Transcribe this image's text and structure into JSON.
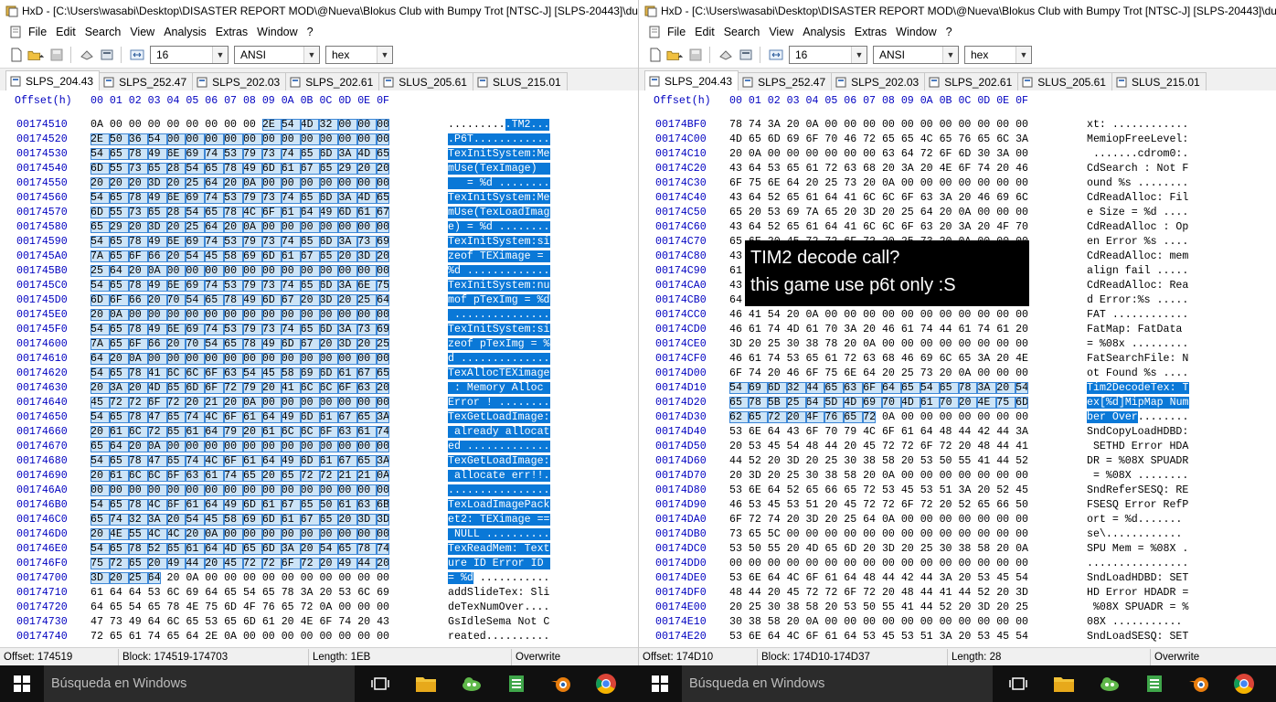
{
  "left": {
    "title": "HxD - [C:\\Users\\wasabi\\Desktop\\DISASTER REPORT MOD\\@Nueva\\Blokus Club with Bumpy Trot [NTSC-J] [SLPS-20443]\\dump\\SLPS_204.43]",
    "menu": [
      "File",
      "Edit",
      "Search",
      "View",
      "Analysis",
      "Extras",
      "Window",
      "?"
    ],
    "toolbar": {
      "bytes_per_row": "16",
      "charset": "ANSI",
      "offset_base": "hex"
    },
    "tabs": [
      "SLPS_204.43",
      "SLPS_252.47",
      "SLPS_202.03",
      "SLPS_202.61",
      "SLUS_205.61",
      "SLUS_215.01"
    ],
    "header": "Offset(h) 00 01 02 03 04 05 06 07 08 09 0A 0B 0C 0D 0E 0F",
    "rows": [
      [
        "00174510",
        "0A 00 00 00 00 00 00 00 00 2E 54 4D 32 00 00 00",
        "..........TM2..."
      ],
      [
        "00174520",
        "2E 50 36 54 00 00 00 00 00 00 00 00 00 00 00 00",
        ".P6T............"
      ],
      [
        "00174530",
        "54 65 78 49 6E 69 74 53 79 73 74 65 6D 3A 4D 65",
        "TexInitSystem:Me"
      ],
      [
        "00174540",
        "6D 55 73 65 28 54 65 78 49 6D 61 67 65 29 20 20",
        "mUse(TexImage)  "
      ],
      [
        "00174550",
        "20 20 20 3D 20 25 64 20 0A 00 00 00 00 00 00 00",
        "   = %d ........"
      ],
      [
        "00174560",
        "54 65 78 49 6E 69 74 53 79 73 74 65 6D 3A 4D 65",
        "TexInitSystem:Me"
      ],
      [
        "00174570",
        "6D 55 73 65 28 54 65 78 4C 6F 61 64 49 6D 61 67",
        "mUse(TexLoadImag"
      ],
      [
        "00174580",
        "65 29 20 3D 20 25 64 20 0A 00 00 00 00 00 00 00",
        "e) = %d ........"
      ],
      [
        "00174590",
        "54 65 78 49 6E 69 74 53 79 73 74 65 6D 3A 73 69",
        "TexInitSystem:si"
      ],
      [
        "001745A0",
        "7A 65 6F 66 20 54 45 58 69 6D 61 67 65 20 3D 20",
        "zeof TEXimage = "
      ],
      [
        "001745B0",
        "25 64 20 0A 00 00 00 00 00 00 00 00 00 00 00 00",
        "%d ............."
      ],
      [
        "001745C0",
        "54 65 78 49 6E 69 74 53 79 73 74 65 6D 3A 6E 75",
        "TexInitSystem:nu"
      ],
      [
        "001745D0",
        "6D 6F 66 20 70 54 65 78 49 6D 67 20 3D 20 25 64",
        "mof pTexImg = %d"
      ],
      [
        "001745E0",
        "20 0A 00 00 00 00 00 00 00 00 00 00 00 00 00 00",
        " ..............."
      ],
      [
        "001745F0",
        "54 65 78 49 6E 69 74 53 79 73 74 65 6D 3A 73 69",
        "TexInitSystem:si"
      ],
      [
        "00174600",
        "7A 65 6F 66 20 70 54 65 78 49 6D 67 20 3D 20 25",
        "zeof pTexImg = %"
      ],
      [
        "00174610",
        "64 20 0A 00 00 00 00 00 00 00 00 00 00 00 00 00",
        "d .............."
      ],
      [
        "00174620",
        "54 65 78 41 6C 6C 6F 63 54 45 58 69 6D 61 67 65",
        "TexAllocTEXimage"
      ],
      [
        "00174630",
        "20 3A 20 4D 65 6D 6F 72 79 20 41 6C 6C 6F 63 20",
        " : Memory Alloc "
      ],
      [
        "00174640",
        "45 72 72 6F 72 20 21 20 0A 00 00 00 00 00 00 00",
        "Error ! ........"
      ],
      [
        "00174650",
        "54 65 78 47 65 74 4C 6F 61 64 49 6D 61 67 65 3A",
        "TexGetLoadImage:"
      ],
      [
        "00174660",
        "20 61 6C 72 65 61 64 79 20 61 6C 6C 6F 63 61 74",
        " already allocat"
      ],
      [
        "00174670",
        "65 64 20 0A 00 00 00 00 00 00 00 00 00 00 00 00",
        "ed ............."
      ],
      [
        "00174680",
        "54 65 78 47 65 74 4C 6F 61 64 49 6D 61 67 65 3A",
        "TexGetLoadImage:"
      ],
      [
        "00174690",
        "20 61 6C 6C 6F 63 61 74 65 20 65 72 72 21 21 0A",
        " allocate err!!."
      ],
      [
        "001746A0",
        "00 00 00 00 00 00 00 00 00 00 00 00 00 00 00 00",
        "................"
      ],
      [
        "001746B0",
        "54 65 78 4C 6F 61 64 49 6D 61 67 65 50 61 63 6B",
        "TexLoadImagePack"
      ],
      [
        "001746C0",
        "65 74 32 3A 20 54 45 58 69 6D 61 67 65 20 3D 3D",
        "et2: TEXimage =="
      ],
      [
        "001746D0",
        "20 4E 55 4C 4C 20 0A 00 00 00 00 00 00 00 00 00",
        " NULL .........."
      ],
      [
        "001746E0",
        "54 65 78 52 65 61 64 4D 65 6D 3A 20 54 65 78 74",
        "TexReadMem: Text"
      ],
      [
        "001746F0",
        "75 72 65 20 49 44 20 45 72 72 6F 72 20 49 44 20",
        "ure ID Error ID "
      ],
      [
        "00174700",
        "3D 20 25 64 20 0A 00 00 00 00 00 00 00 00 00 00",
        "= %d ..........."
      ],
      [
        "00174710",
        "61 64 64 53 6C 69 64 65 54 65 78 3A 20 53 6C 69",
        "addSlideTex: Sli"
      ],
      [
        "00174720",
        "64 65 54 65 78 4E 75 6D 4F 76 65 72 0A 00 00 00",
        "deTexNumOver...."
      ],
      [
        "00174730",
        "47 73 49 64 6C 65 53 65 6D 61 20 4E 6F 74 20 43",
        "GsIdleSema Not C"
      ],
      [
        "00174740",
        "72 65 61 74 65 64 2E 0A 00 00 00 00 00 00 00 00",
        "reated.........."
      ]
    ],
    "status": {
      "offset": "Offset: 174519",
      "block": "Block: 174519-174703",
      "length": "Length: 1EB",
      "mode": "Overwrite"
    }
  },
  "right": {
    "title": "HxD - [C:\\Users\\wasabi\\Desktop\\DISASTER REPORT MOD\\@Nueva\\Blokus Club with Bumpy Trot [NTSC-J] [SLPS-20443]\\dump\\SLPS_204.43]",
    "menu": [
      "File",
      "Edit",
      "Search",
      "View",
      "Analysis",
      "Extras",
      "Window",
      "?"
    ],
    "toolbar": {
      "bytes_per_row": "16",
      "charset": "ANSI",
      "offset_base": "hex"
    },
    "tabs": [
      "SLPS_204.43",
      "SLPS_252.47",
      "SLPS_202.03",
      "SLPS_202.61",
      "SLUS_205.61",
      "SLUS_215.01"
    ],
    "header": "Offset(h) 00 01 02 03 04 05 06 07 08 09 0A 0B 0C 0D 0E 0F",
    "rows": [
      [
        "00174BF0",
        "78 74 3A 20 0A 00 00 00 00 00 00 00 00 00 00 00",
        "xt: ............"
      ],
      [
        "00174C00",
        "4D 65 6D 69 6F 70 46 72 65 65 4C 65 76 65 6C 3A",
        "MemiopFreeLevel:"
      ],
      [
        "00174C10",
        "20 0A 00 00 00 00 00 00 63 64 72 6F 6D 30 3A 00",
        " .......cdrom0:."
      ],
      [
        "00174C20",
        "43 64 53 65 61 72 63 68 20 3A 20 4E 6F 74 20 46",
        "CdSearch : Not F"
      ],
      [
        "00174C30",
        "6F 75 6E 64 20 25 73 20 0A 00 00 00 00 00 00 00",
        "ound %s ........"
      ],
      [
        "00174C40",
        "43 64 52 65 61 64 41 6C 6C 6F 63 3A 20 46 69 6C",
        "CdReadAlloc: Fil"
      ],
      [
        "00174C50",
        "65 20 53 69 7A 65 20 3D 20 25 64 20 0A 00 00 00",
        "e Size = %d ...."
      ],
      [
        "00174C60",
        "43 64 52 65 61 64 41 6C 6C 6F 63 20 3A 20 4F 70",
        "CdReadAlloc : Op"
      ],
      [
        "00174C70",
        "65 6E 20 45 72 72 6F 72 20 25 73 20 0A 00 00 00",
        "en Error %s ...."
      ],
      [
        "00174C80",
        "43 64 52 65 61 64 41 6C 6C 6F 63 3A 20 6D 65 6D",
        "CdReadAlloc: mem"
      ],
      [
        "00174C90",
        "61 6C 69 67 6E 20 66 61 69 6C 20 0A 00 00 00 00",
        "align fail ....."
      ],
      [
        "00174CA0",
        "43 64 52 65 61 64 41 6C 6C 6F 63 3A 20 52 65 61",
        "CdReadAlloc: Rea"
      ],
      [
        "00174CB0",
        "64 20 45 72 72 6F 72 3A 25 73 20 0A 00 00 00 00",
        "d Error:%s ....."
      ],
      [
        "00174CC0",
        "46 41 54 20 0A 00 00 00 00 00 00 00 00 00 00 00",
        "FAT ............"
      ],
      [
        "00174CD0",
        "46 61 74 4D 61 70 3A 20 46 61 74 44 61 74 61 20",
        "FatMap: FatData "
      ],
      [
        "00174CE0",
        "3D 20 25 30 38 78 20 0A 00 00 00 00 00 00 00 00",
        "= %08x ........."
      ],
      [
        "00174CF0",
        "46 61 74 53 65 61 72 63 68 46 69 6C 65 3A 20 4E",
        "FatSearchFile: N"
      ],
      [
        "00174D00",
        "6F 74 20 46 6F 75 6E 64 20 25 73 20 0A 00 00 00",
        "ot Found %s ...."
      ],
      [
        "00174D10",
        "54 69 6D 32 44 65 63 6F 64 65 54 65 78 3A 20 54",
        "Tim2DecodeTex: T"
      ],
      [
        "00174D20",
        "65 78 5B 25 64 5D 4D 69 70 4D 61 70 20 4E 75 6D",
        "ex[%d]MipMap Num"
      ],
      [
        "00174D30",
        "62 65 72 20 4F 76 65 72 0A 00 00 00 00 00 00 00",
        "ber Over........"
      ],
      [
        "00174D40",
        "53 6E 64 43 6F 70 79 4C 6F 61 64 48 44 42 44 3A",
        "SndCopyLoadHDBD:"
      ],
      [
        "00174D50",
        "20 53 45 54 48 44 20 45 72 72 6F 72 20 48 44 41",
        " SETHD Error HDA"
      ],
      [
        "00174D60",
        "44 52 20 3D 20 25 30 38 58 20 53 50 55 41 44 52",
        "DR = %08X SPUADR"
      ],
      [
        "00174D70",
        "20 3D 20 25 30 38 58 20 0A 00 00 00 00 00 00 00",
        " = %08X ........"
      ],
      [
        "00174D80",
        "53 6E 64 52 65 66 65 72 53 45 53 51 3A 20 52 45",
        "SndReferSESQ: RE"
      ],
      [
        "00174D90",
        "46 53 45 53 51 20 45 72 72 6F 72 20 52 65 66 50",
        "FSESQ Error RefP"
      ],
      [
        "00174DA0",
        "6F 72 74 20 3D 20 25 64 0A 00 00 00 00 00 00 00",
        "ort = %d......."
      ],
      [
        "00174DB0",
        "73 65 5C 00 00 00 00 00 00 00 00 00 00 00 00 00",
        "se\\............"
      ],
      [
        "00174DC0",
        "53 50 55 20 4D 65 6D 20 3D 20 25 30 38 58 20 0A",
        "SPU Mem = %08X ."
      ],
      [
        "00174DD0",
        "00 00 00 00 00 00 00 00 00 00 00 00 00 00 00 00",
        "................"
      ],
      [
        "00174DE0",
        "53 6E 64 4C 6F 61 64 48 44 42 44 3A 20 53 45 54",
        "SndLoadHDBD: SET"
      ],
      [
        "00174DF0",
        "48 44 20 45 72 72 6F 72 20 48 44 41 44 52 20 3D",
        "HD Error HDADR ="
      ],
      [
        "00174E00",
        "20 25 30 38 58 20 53 50 55 41 44 52 20 3D 20 25",
        " %08X SPUADR = %"
      ],
      [
        "00174E10",
        "30 38 58 20 0A 00 00 00 00 00 00 00 00 00 00 00",
        "08X ..........."
      ],
      [
        "00174E20",
        "53 6E 64 4C 6F 61 64 53 45 53 51 3A 20 53 45 54",
        "SndLoadSESQ: SET"
      ]
    ],
    "status": {
      "offset": "Offset: 174D10",
      "block": "Block: 174D10-174D37",
      "length": "Length: 28",
      "mode": "Overwrite"
    }
  },
  "overlay": {
    "line1": "TIM2 decode call?",
    "line2": "this game use p6t only :S"
  },
  "taskbar": {
    "search_placeholder": "Búsqueda en Windows",
    "icons": [
      "windows-start-icon",
      "task-view-icon",
      "file-explorer-icon",
      "cloud-app-icon",
      "notepad-app-icon",
      "blender-icon",
      "chrome-icon"
    ]
  },
  "colors": {
    "offset_blue": "#0000c0",
    "selection_bytes_bg": "#cde4f7",
    "selection_ascii_bg": "#0a78d7",
    "taskbar_bg": "#101010",
    "overlay_bg": "#000000"
  }
}
